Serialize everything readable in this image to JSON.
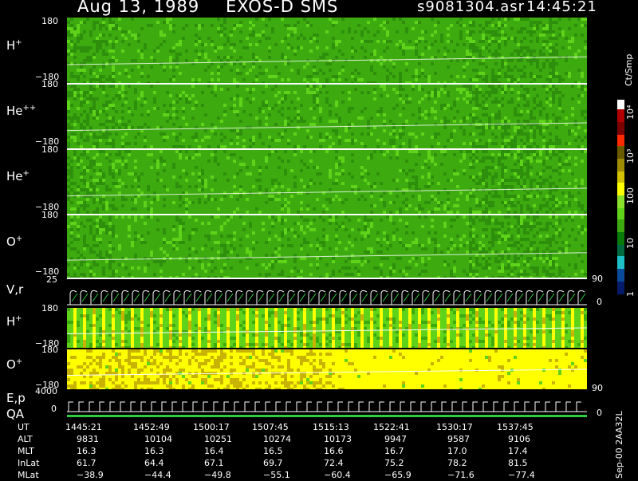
{
  "header": {
    "date": "Aug 13, 1989",
    "instrument": "EXOS-D SMS",
    "file": "s9081304.asr",
    "time": "14:45:21"
  },
  "colorbar": {
    "unit": "Ct/Smp",
    "labels": [
      "10⁴",
      "10³",
      "100",
      "10",
      "1"
    ]
  },
  "panels": [
    {
      "ion": "H",
      "charge": "+",
      "ymax": "180",
      "ymin": "−180"
    },
    {
      "ion": "He",
      "charge": "++",
      "ymax": "180",
      "ymin": "−180"
    },
    {
      "ion": "He",
      "charge": "+",
      "ymax": "180",
      "ymin": "−180"
    },
    {
      "ion": "O",
      "charge": "+",
      "ymax": "180",
      "ymin": "−180"
    }
  ],
  "vr_panel": {
    "label": "V,r",
    "ymax": "25",
    "ymin": "0",
    "right_top": "90",
    "right_bottom": "0"
  },
  "lower_panels": [
    {
      "ion": "H",
      "charge": "+",
      "ymax": "180",
      "ymin": "−180"
    },
    {
      "ion": "O",
      "charge": "+",
      "ymax": "180",
      "ymin": "−180"
    }
  ],
  "ep_panel": {
    "label1": "E,p",
    "label2": "QA",
    "ymax": "4000",
    "ymin": "0",
    "right_top": "90",
    "right_bottom": "0"
  },
  "table": {
    "rows": [
      {
        "label": "UT",
        "values": [
          "1445:21",
          "1452:49",
          "1500:17",
          "1507:45",
          "1515:13",
          "1522:41",
          "1530:17",
          "1537:45"
        ]
      },
      {
        "label": "ALT",
        "values": [
          "9831",
          "10104",
          "10251",
          "10274",
          "10173",
          "9947",
          "9587",
          "9106"
        ]
      },
      {
        "label": "MLT",
        "values": [
          "16.3",
          "16.3",
          "16.4",
          "16.5",
          "16.6",
          "16.7",
          "17.0",
          "17.4"
        ]
      },
      {
        "label": "InLat",
        "values": [
          "61.7",
          "64.4",
          "67.1",
          "69.7",
          "72.4",
          "75.2",
          "78.2",
          "81.5"
        ]
      },
      {
        "label": "MLat",
        "values": [
          "−38.9",
          "−44.4",
          "−49.8",
          "−55.1",
          "−60.4",
          "−65.9",
          "−71.6",
          "−77.4"
        ]
      }
    ]
  },
  "footer_code": "Sep-00  2AA32L",
  "colors": {
    "green": "#3dab10",
    "dark_green": "#2e8f0c",
    "light_green": "#5fd21a",
    "yellow": "#ffff00",
    "olive": "#c8b400"
  },
  "chart_data": {
    "type": "heatmap",
    "title": "Aug 13, 1989   EXOS-D SMS",
    "x_ticks_ut": [
      "1445:21",
      "1452:49",
      "1500:17",
      "1507:45",
      "1515:13",
      "1522:41",
      "1530:17",
      "1537:45"
    ],
    "y_range": [
      -180,
      180
    ],
    "color_scale": [
      "1",
      "10",
      "100",
      "10³",
      "10⁴"
    ],
    "color_unit": "Ct/Smp"
  }
}
